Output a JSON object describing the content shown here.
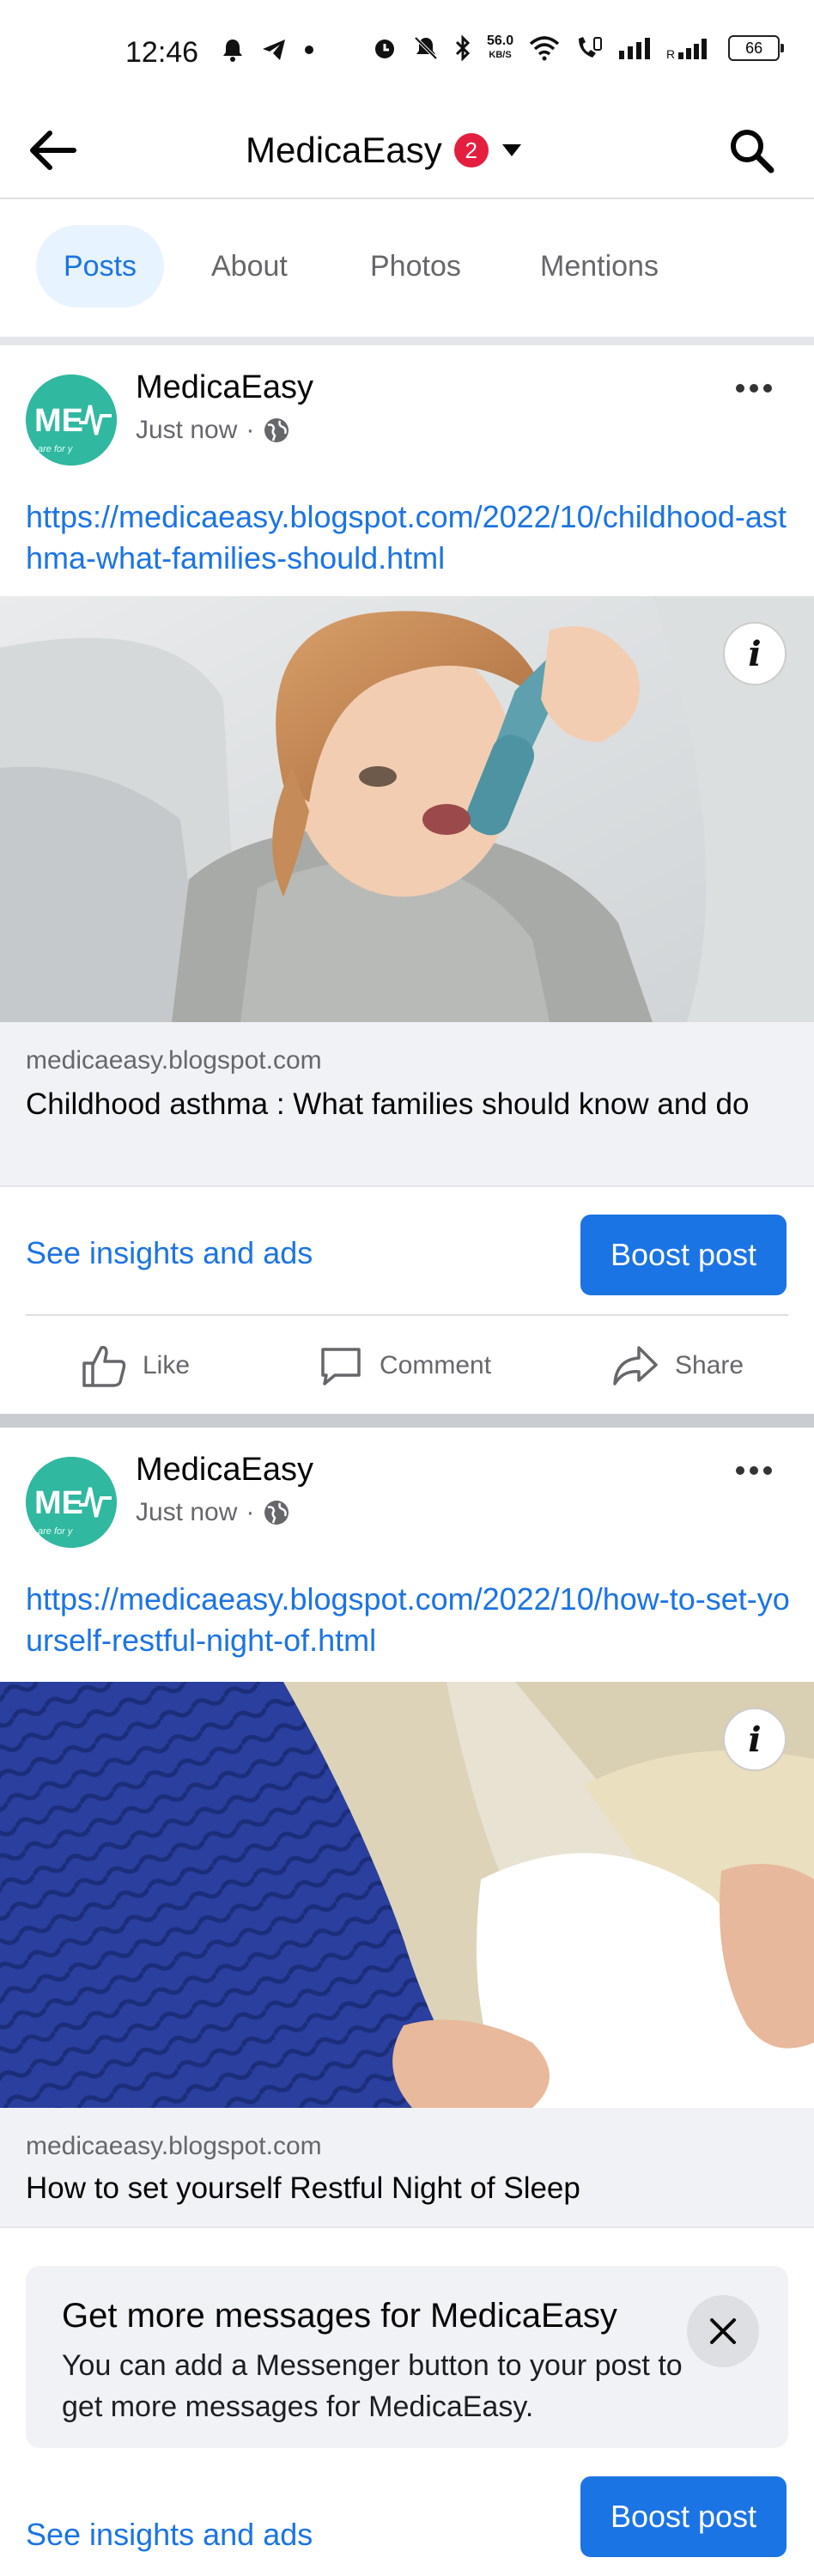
{
  "status_bar": {
    "time": "12:46",
    "network_speed_value": "56.0",
    "network_speed_unit": "KB/S",
    "network_type": "R",
    "battery": "66"
  },
  "header": {
    "title": "MedicaEasy",
    "badge_count": "2"
  },
  "tabs": [
    {
      "label": "Posts",
      "active": true
    },
    {
      "label": "About",
      "active": false
    },
    {
      "label": "Photos",
      "active": false
    },
    {
      "label": "Mentions",
      "active": false
    }
  ],
  "posts": [
    {
      "author": "MedicaEasy",
      "time": "Just now",
      "separator": "·",
      "avatar_text": "ME",
      "avatar_subtext": "are for y",
      "link": "https://medicaeasy.blogspot.com/2022/10/childhood-asthma-what-families-should.html",
      "preview_domain": "medicaeasy.blogspot.com",
      "preview_title": "Childhood asthma : What families should know and do",
      "insights_label": "See insights and ads",
      "boost_label": "Boost post",
      "actions": {
        "like": "Like",
        "comment": "Comment",
        "share": "Share"
      }
    },
    {
      "author": "MedicaEasy",
      "time": "Just now",
      "separator": "·",
      "avatar_text": "ME",
      "avatar_subtext": "are for y",
      "link": "https://medicaeasy.blogspot.com/2022/10/how-to-set-yourself-restful-night-of.html",
      "preview_domain": "medicaeasy.blogspot.com",
      "preview_title": "How to set yourself Restful Night of Sleep",
      "insights_label": "See insights and ads",
      "boost_label": "Boost post"
    }
  ],
  "messenger_prompt": {
    "title": "Get more messages for MedicaEasy",
    "body": "You can add a Messenger button to your post to get more messages for MedicaEasy."
  },
  "colors": {
    "accent": "#1b74e4",
    "badge": "#e41e3f",
    "avatar": "#30b8a0"
  }
}
